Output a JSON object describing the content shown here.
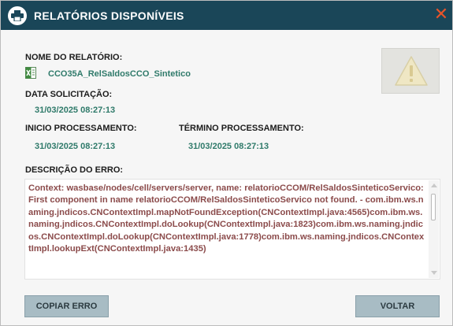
{
  "dialog": {
    "title": "RELATÓRIOS DISPONÍVEIS",
    "close_glyph": "✕"
  },
  "report": {
    "name_label": "NOME DO RELATÓRIO:",
    "name_value": "CCO35A_RelSaldosCCO_Sintetico",
    "file_icon": "excel-file-icon",
    "request_date_label": "DATA SOLICITAÇÃO:",
    "request_date_value": "31/03/2025 08:27:13",
    "start_label": "INICIO PROCESSAMENTO:",
    "start_value": "31/03/2025 08:27:13",
    "end_label": "TÉRMINO PROCESSAMENTO:",
    "end_value": "31/03/2025 08:27:13",
    "status_icon": "warning-icon"
  },
  "error": {
    "label": "DESCRIÇÃO DO ERRO:",
    "text": "Context: wasbase/nodes/cell/servers/server, name: relatorioCCOM/RelSaldosSinteticoServico: First component in name relatorioCCOM/RelSaldosSinteticoServico not found. - com.ibm.ws.naming.jndicos.CNContextImpl.mapNotFoundException(CNContextImpl.java:4565)com.ibm.ws.naming.jndicos.CNContextImpl.doLookup(CNContextImpl.java:1823)com.ibm.ws.naming.jndicos.CNContextImpl.doLookup(CNContextImpl.java:1778)com.ibm.ws.naming.jndicos.CNContextImpl.lookupExt(CNContextImpl.java:1435)"
  },
  "buttons": {
    "copy_label": "COPIAR ERRO",
    "back_label": "VOLTAR"
  },
  "colors": {
    "titlebar": "#1a4658",
    "close": "#e8542a",
    "value_text": "#2f7a6a",
    "error_text": "#8b4b4b",
    "button_bg": "#a8bcc4"
  }
}
